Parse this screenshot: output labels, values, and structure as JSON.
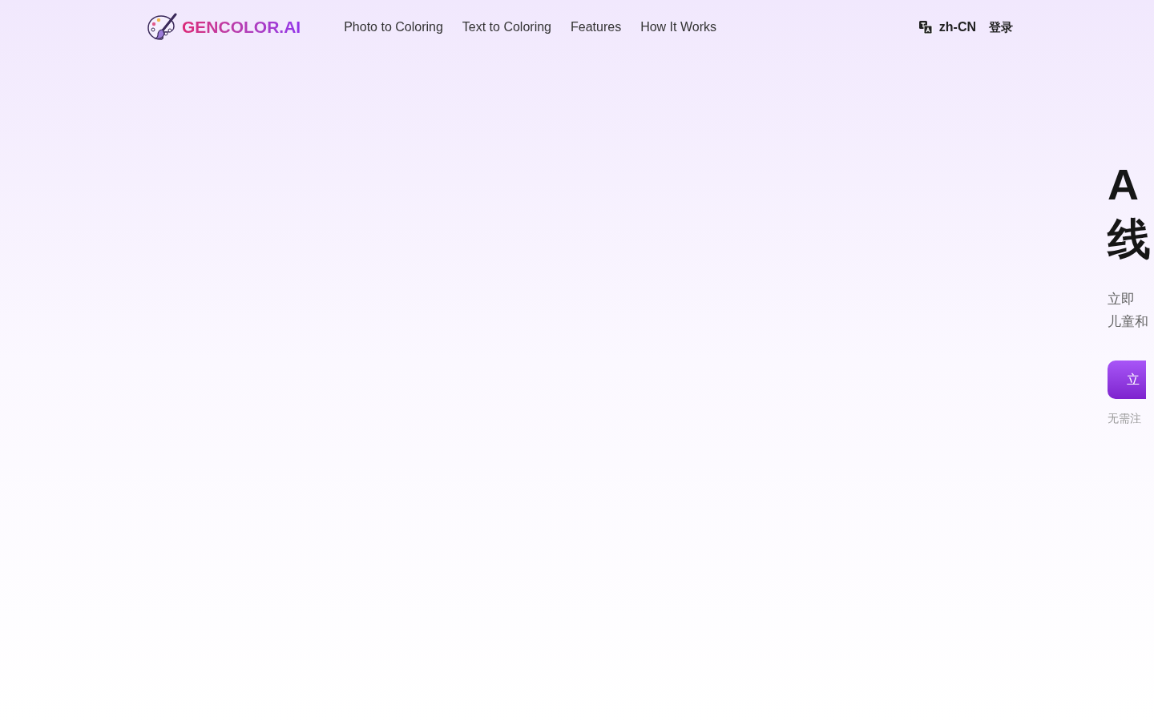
{
  "header": {
    "logo": "GENCOLOR.AI",
    "nav": [
      "Photo to Coloring",
      "Text to Coloring",
      "Features",
      "How It Works"
    ],
    "language": "zh-CN",
    "login": "登录"
  },
  "hero": {
    "title_lines": [
      "A",
      "线"
    ],
    "subtitle_lines": [
      "立即",
      "儿童和"
    ],
    "cta": "立",
    "note": "无需注"
  }
}
